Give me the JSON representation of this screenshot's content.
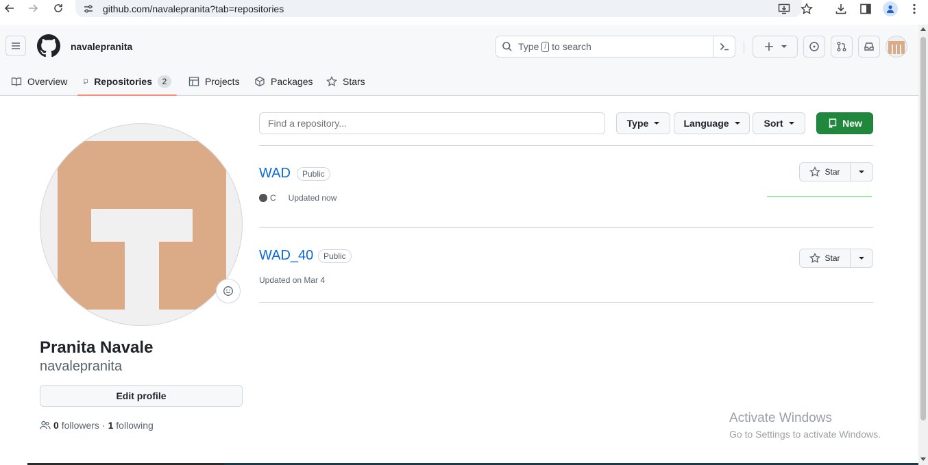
{
  "browser": {
    "url": "github.com/navalepranita?tab=repositories"
  },
  "header": {
    "username": "navalepranita",
    "search": {
      "prefix": "Type",
      "slash_key": "/",
      "suffix": "to search"
    },
    "plus_label": "+"
  },
  "tabs": [
    {
      "label": "Overview",
      "icon": "book-icon",
      "active": false
    },
    {
      "label": "Repositories",
      "icon": "repo-icon",
      "active": true,
      "count": "2"
    },
    {
      "label": "Projects",
      "icon": "table-icon",
      "active": false
    },
    {
      "label": "Packages",
      "icon": "package-icon",
      "active": false
    },
    {
      "label": "Stars",
      "icon": "star-icon",
      "active": false
    }
  ],
  "profile": {
    "full_name": "Pranita Navale",
    "login": "navalepranita",
    "edit_label": "Edit profile",
    "followers_count": "0",
    "followers_label": "followers",
    "separator": "·",
    "following_count": "1",
    "following_label": "following",
    "avatar_color": "#dbab87"
  },
  "repo_filter": {
    "placeholder": "Find a repository...",
    "type_label": "Type",
    "language_label": "Language",
    "sort_label": "Sort",
    "new_label": "New"
  },
  "repos": [
    {
      "name": "WAD",
      "visibility": "Public",
      "language": "C",
      "language_color": "#555555",
      "updated": "Updated now",
      "star_label": "Star"
    },
    {
      "name": "WAD_40",
      "visibility": "Public",
      "updated": "Updated on Mar 4",
      "star_label": "Star"
    }
  ],
  "watermark": {
    "title": "Activate Windows",
    "subtitle": "Go to Settings to activate Windows."
  },
  "colors": {
    "accent_tab": "#fd8c73",
    "link": "#0969da",
    "new_button": "#1f883d"
  }
}
